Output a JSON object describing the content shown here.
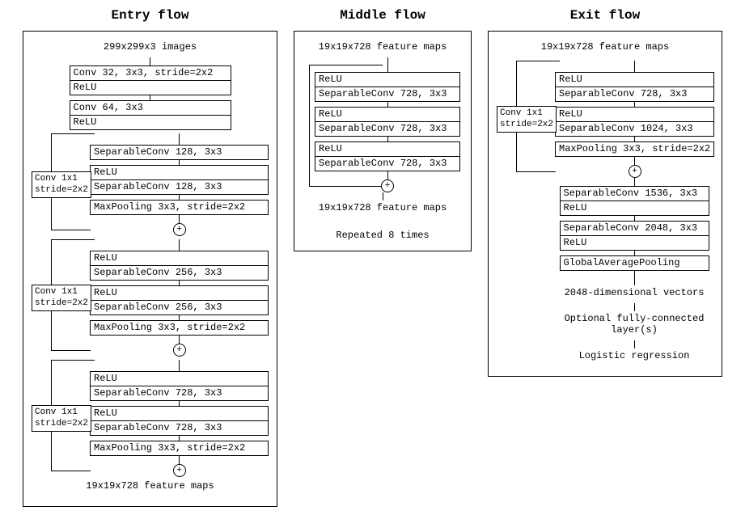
{
  "entry": {
    "title": "Entry flow",
    "input": "299x299x3 images",
    "conv1": "Conv 32, 3x3, stride=2x2",
    "relu": "ReLU",
    "conv2": "Conv 64, 3x3",
    "skip_label_l1": "Conv 1x1",
    "skip_label_l2": "stride=2x2",
    "b1_sep1": "SeparableConv 128, 3x3",
    "b1_sep2": "SeparableConv 128, 3x3",
    "b1_pool": "MaxPooling 3x3, stride=2x2",
    "b2_sep1": "SeparableConv 256, 3x3",
    "b2_sep2": "SeparableConv 256, 3x3",
    "b2_pool": "MaxPooling 3x3, stride=2x2",
    "b3_sep1": "SeparableConv 728, 3x3",
    "b3_sep2": "SeparableConv 728, 3x3",
    "b3_pool": "MaxPooling 3x3, stride=2x2",
    "output": "19x19x728 feature maps"
  },
  "middle": {
    "title": "Middle flow",
    "input": "19x19x728 feature maps",
    "sep": "SeparableConv 728, 3x3",
    "relu": "ReLU",
    "output": "19x19x728 feature maps",
    "repeat": "Repeated 8 times"
  },
  "exit": {
    "title": "Exit flow",
    "input": "19x19x728 feature maps",
    "skip_label_l1": "Conv 1x1",
    "skip_label_l2": "stride=2x2",
    "relu": "ReLU",
    "b_sep1": "SeparableConv 728, 3x3",
    "b_sep2": "SeparableConv 1024, 3x3",
    "b_pool": "MaxPooling 3x3, stride=2x2",
    "sep3": "SeparableConv 1536, 3x3",
    "sep4": "SeparableConv 2048, 3x3",
    "gap": "GlobalAveragePooling",
    "out_vec": "2048-dimensional vectors",
    "out_fc": "Optional fully-connected layer(s)",
    "out_lr": "Logistic regression"
  }
}
